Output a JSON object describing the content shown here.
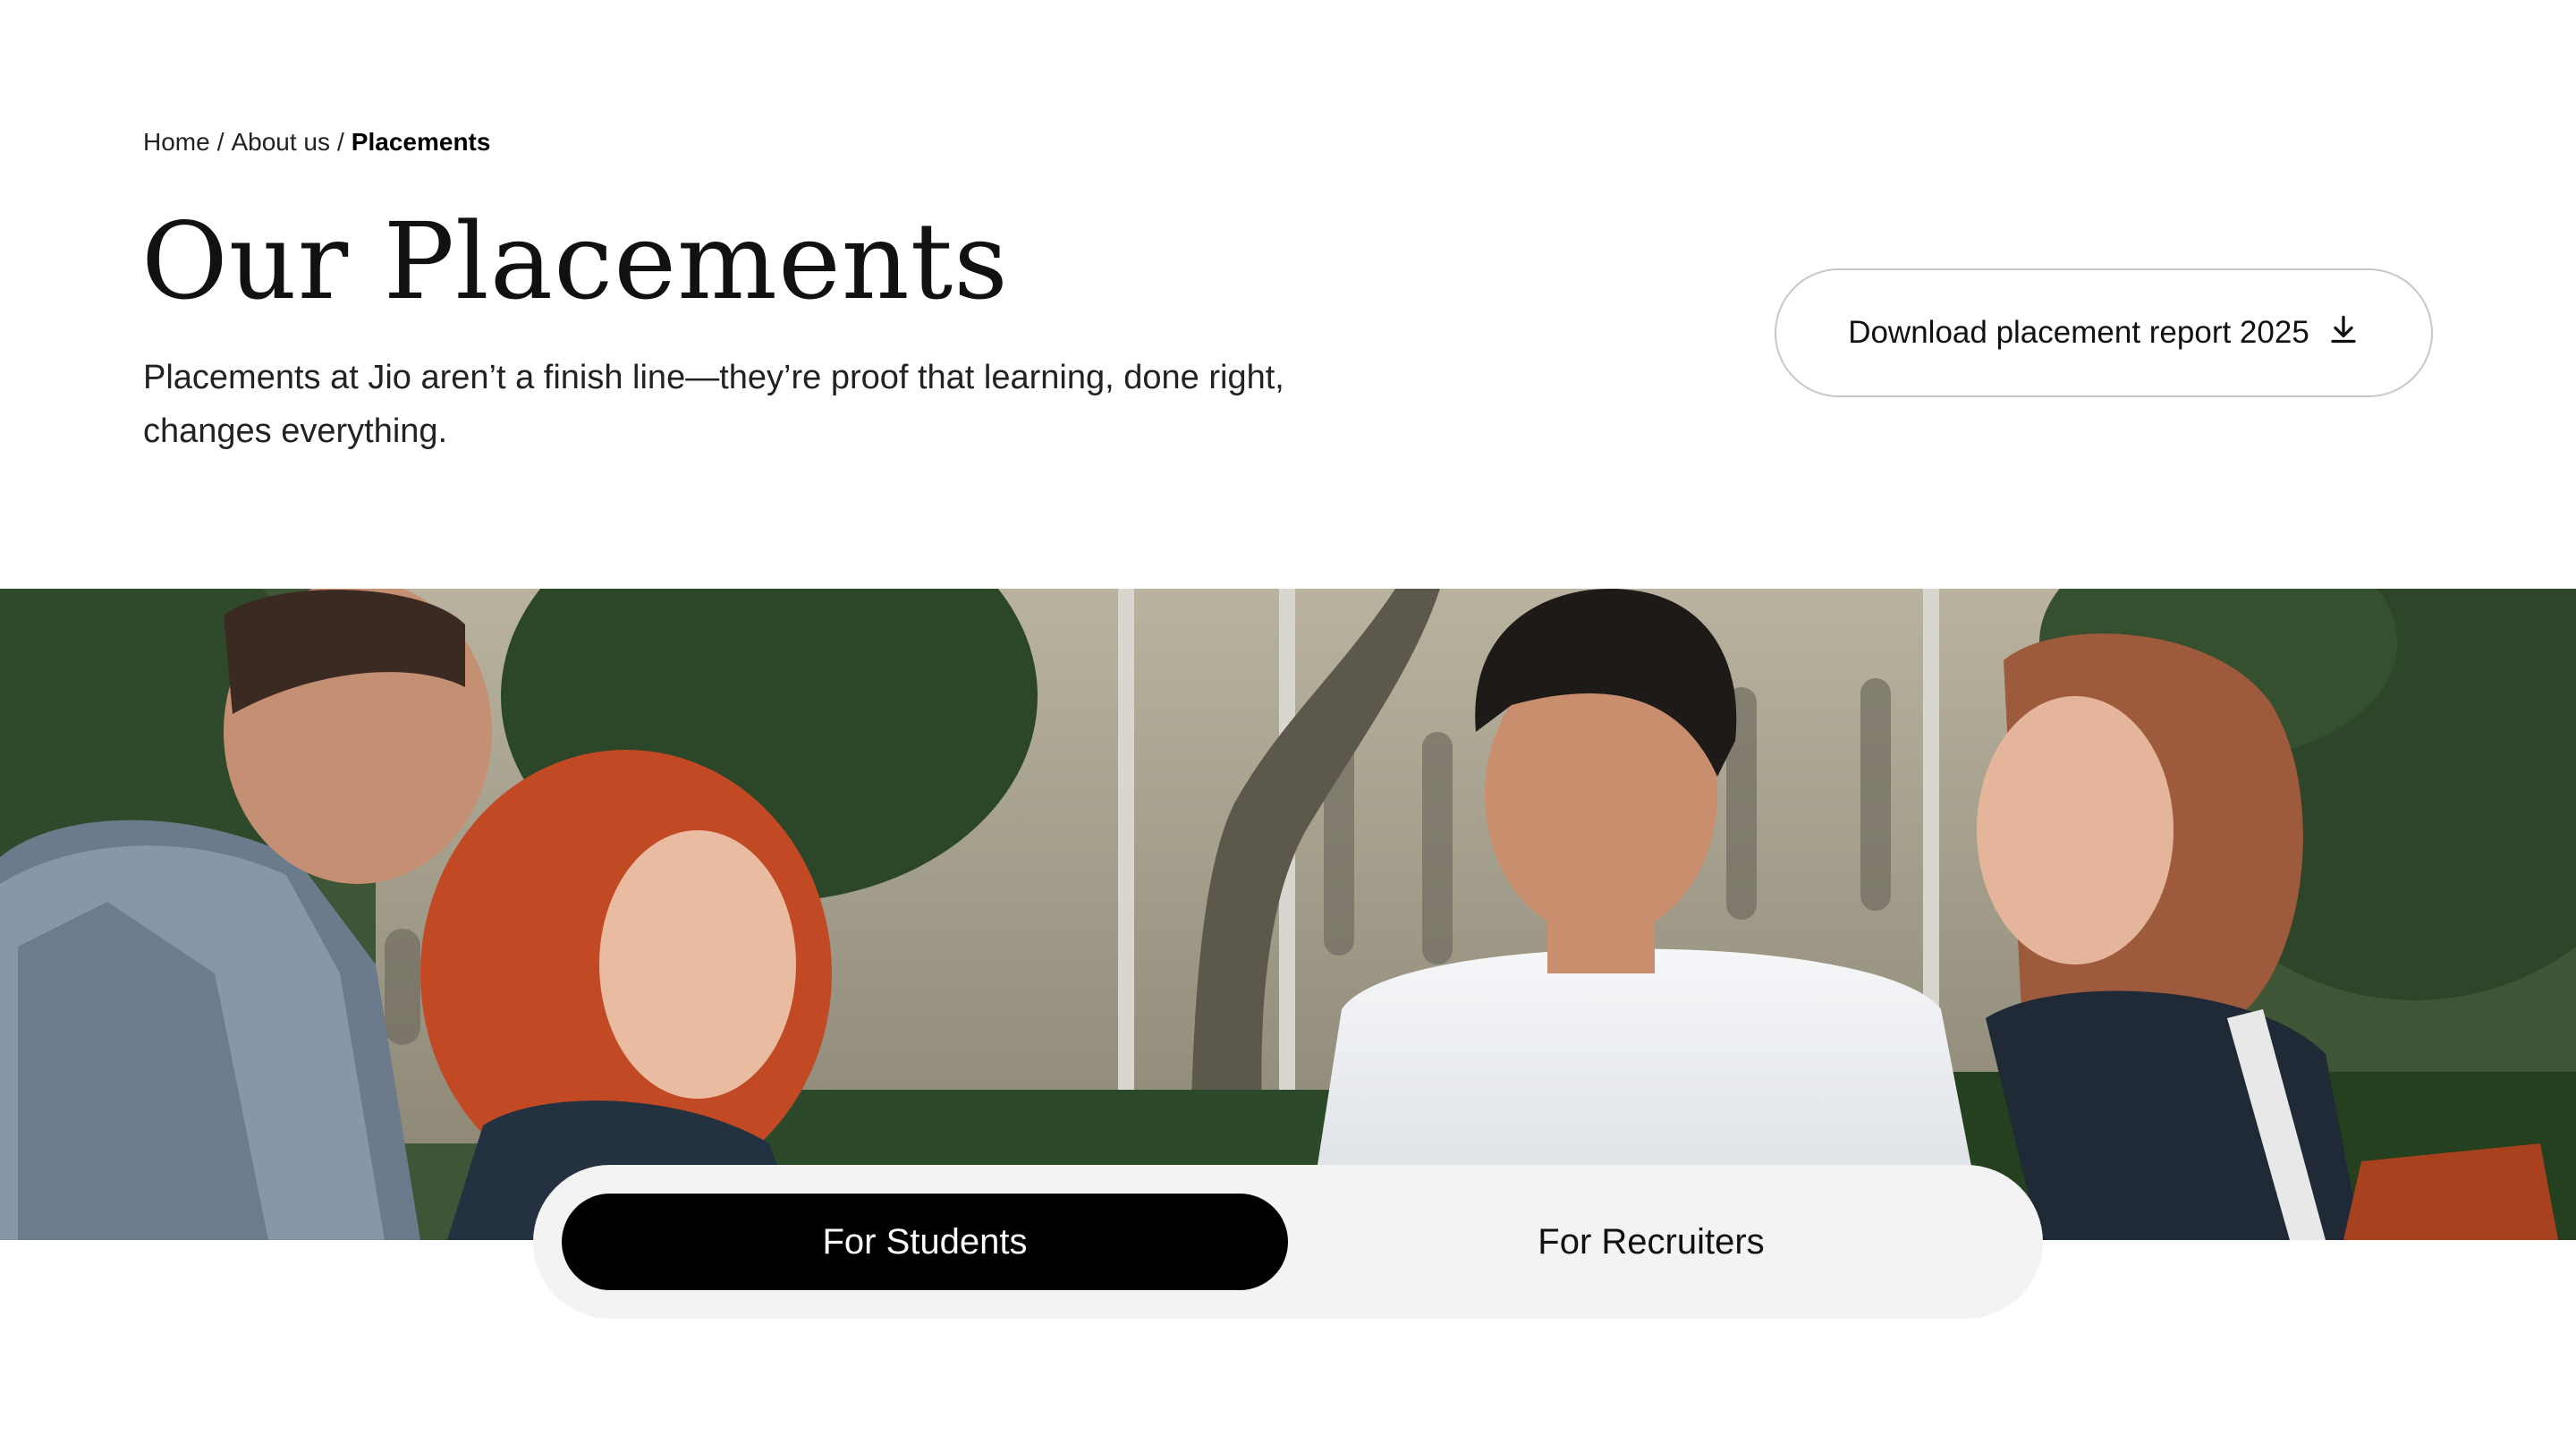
{
  "breadcrumb": {
    "items": [
      "Home",
      "About us"
    ],
    "separator": "/",
    "current": "Placements"
  },
  "page": {
    "title": "Our Placements",
    "subtitle": "Placements at Jio aren’t a finish line—they’re proof that learning, done right, changes everything."
  },
  "download_button": {
    "label": "Download placement report 2025",
    "icon": "download-icon"
  },
  "hero_image": {
    "subject": "group-of-students-outdoors"
  },
  "tabs": [
    {
      "label": "For Students",
      "active": true
    },
    {
      "label": "For Recruiters",
      "active": false
    }
  ],
  "colors": {
    "accent": "#000000",
    "tabs_background": "#f3f3f3",
    "button_border": "#c7c7c7"
  }
}
